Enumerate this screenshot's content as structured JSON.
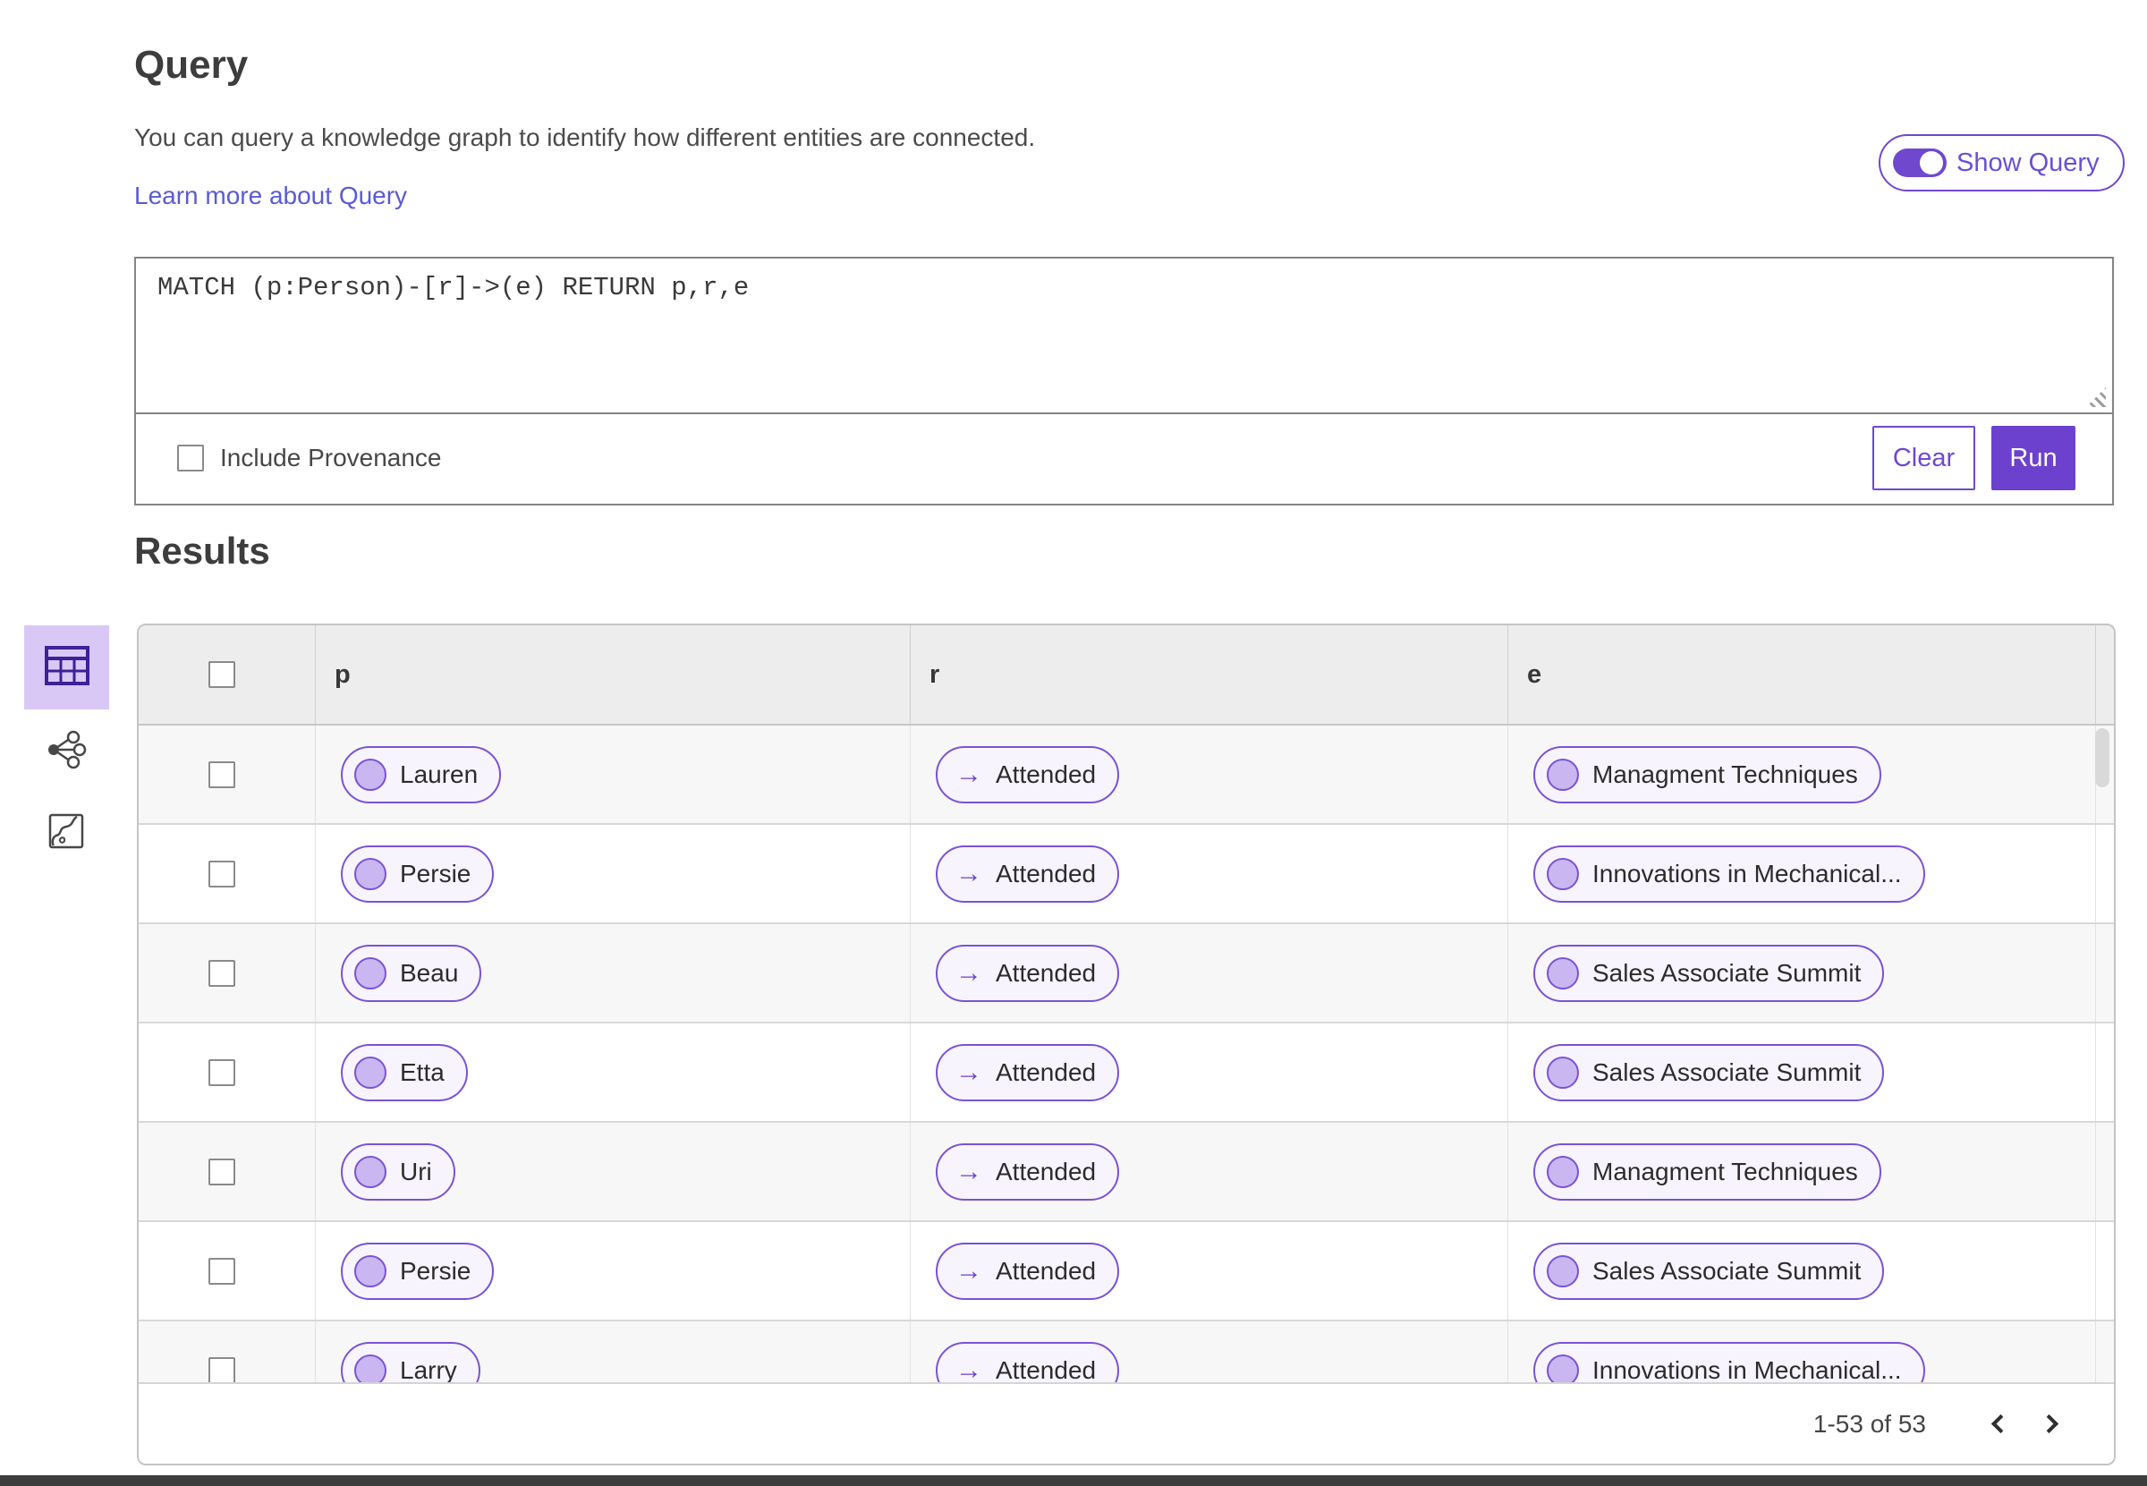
{
  "query": {
    "title": "Query",
    "description": "You can query a knowledge graph to identify how different entities are connected.",
    "learn_more_link": "Learn more about Query",
    "show_query_label": "Show Query",
    "show_query_on": true,
    "editor_text": "MATCH (p:Person)-[r]->(e) RETURN p,r,e",
    "include_provenance_label": "Include Provenance",
    "include_provenance_checked": false,
    "clear_button": "Clear",
    "run_button": "Run"
  },
  "results": {
    "title": "Results",
    "views": [
      {
        "name": "table-view",
        "active": true
      },
      {
        "name": "graph-view",
        "active": false
      },
      {
        "name": "map-view",
        "active": false
      }
    ],
    "table": {
      "columns": [
        "p",
        "r",
        "e"
      ],
      "arrow": "→",
      "rows": [
        {
          "p": "Lauren",
          "r": "Attended",
          "e": "Managment Techniques"
        },
        {
          "p": "Persie",
          "r": "Attended",
          "e": "Innovations in Mechanical..."
        },
        {
          "p": "Beau",
          "r": "Attended",
          "e": "Sales Associate Summit"
        },
        {
          "p": "Etta",
          "r": "Attended",
          "e": "Sales Associate Summit"
        },
        {
          "p": "Uri",
          "r": "Attended",
          "e": "Managment Techniques"
        },
        {
          "p": "Persie",
          "r": "Attended",
          "e": "Sales Associate Summit"
        },
        {
          "p": "Larry",
          "r": "Attended",
          "e": "Innovations in Mechanical..."
        }
      ]
    },
    "pagination": {
      "range_text": "1-53 of 53"
    }
  },
  "colors": {
    "accent_purple": "#6b41cd",
    "link_purple": "#5a5ad6",
    "pill_background": "#f7f4fd",
    "node_circle_fill": "#cab7f1",
    "active_view_background": "#d9c8f6",
    "table_header_background": "#ededed",
    "row_stripe": "#f7f7f7",
    "bottom_bar": "#3d3d3d"
  }
}
